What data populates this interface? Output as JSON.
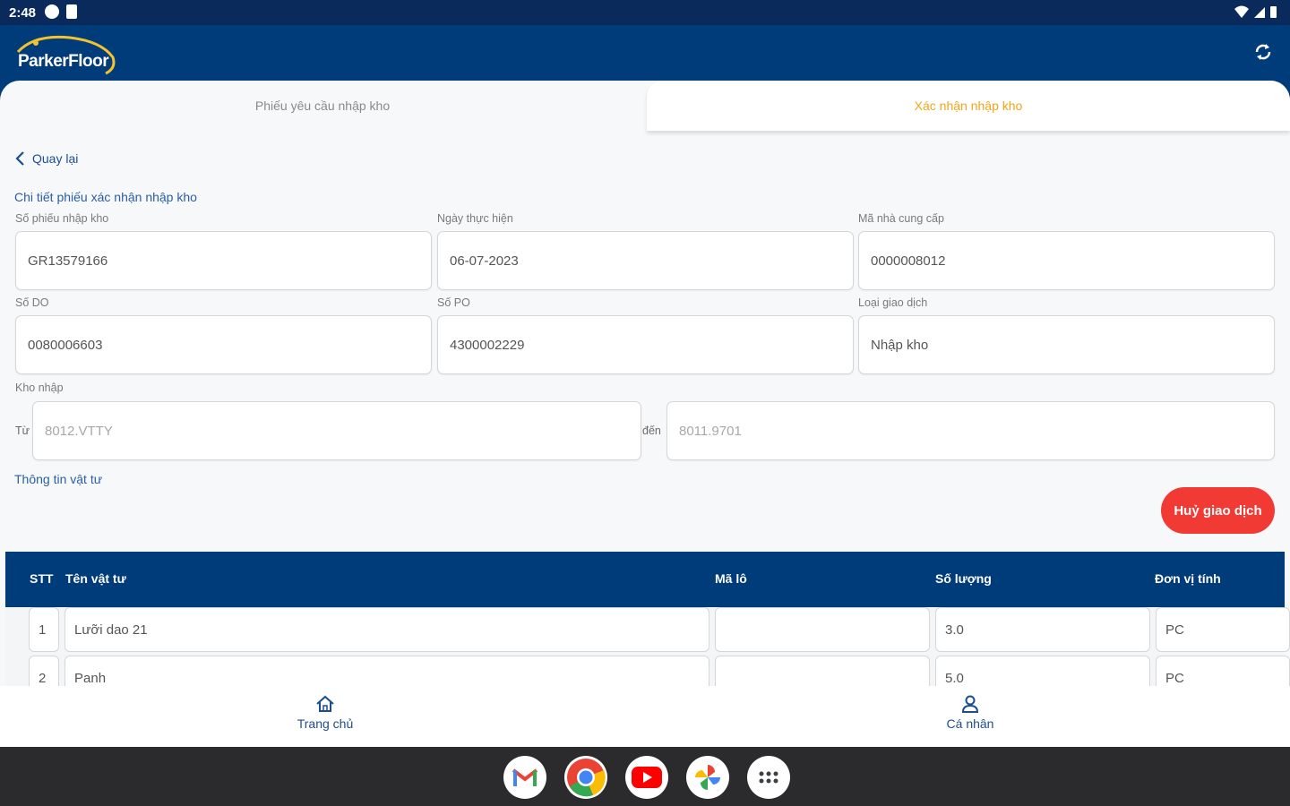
{
  "status_bar": {
    "time": "2:48"
  },
  "app": {
    "logo_text": "ParkerFloor"
  },
  "tabs": [
    {
      "label": "Phiếu yêu cầu nhập kho",
      "active": false
    },
    {
      "label": "Xác nhận nhập kho",
      "active": true
    }
  ],
  "back_label": "Quay lại",
  "section_title": "Chi tiết phiếu xác nhận nhập kho",
  "form": {
    "receipt_no": {
      "label": "Số phiếu nhập kho",
      "value": "GR13579166"
    },
    "date": {
      "label": "Ngày thực hiện",
      "value": "06-07-2023"
    },
    "supplier_code": {
      "label": "Mã nhà cung cấp",
      "value": "0000008012"
    },
    "do_no": {
      "label": "Số DO",
      "value": "0080006603"
    },
    "po_no": {
      "label": "Số PO",
      "value": "4300002229"
    },
    "transaction_type": {
      "label": "Loại giao dịch",
      "value": "Nhập kho"
    },
    "warehouse": {
      "label": "Kho nhập",
      "from_label": "Từ",
      "from_value": "8012.VTTY",
      "to_label": "đến",
      "to_value": "8011.9701"
    }
  },
  "materials_title": "Thông tin vật tư",
  "cancel_button": "Huỷ giao dịch",
  "table": {
    "headers": {
      "stt": "STT",
      "name": "Tên vật tư",
      "lot": "Mã lô",
      "qty": "Số lượng",
      "unit": "Đơn vị tính"
    },
    "rows": [
      {
        "stt": "1",
        "name": "Lưỡi dao 21",
        "lot": "",
        "qty": "3.0",
        "unit": "PC"
      },
      {
        "stt": "2",
        "name": "Panh",
        "lot": "",
        "qty": "5.0",
        "unit": "PC"
      }
    ]
  },
  "bottom_nav": [
    {
      "label": "Trang chủ",
      "icon": "home-icon"
    },
    {
      "label": "Cá nhân",
      "icon": "person-icon"
    }
  ],
  "dock_apps": [
    "gmail-icon",
    "chrome-icon",
    "youtube-icon",
    "photos-icon",
    "app-drawer-icon"
  ],
  "colors": {
    "primary": "#003b7a",
    "accent": "#f2a516",
    "danger": "#f23a35"
  }
}
